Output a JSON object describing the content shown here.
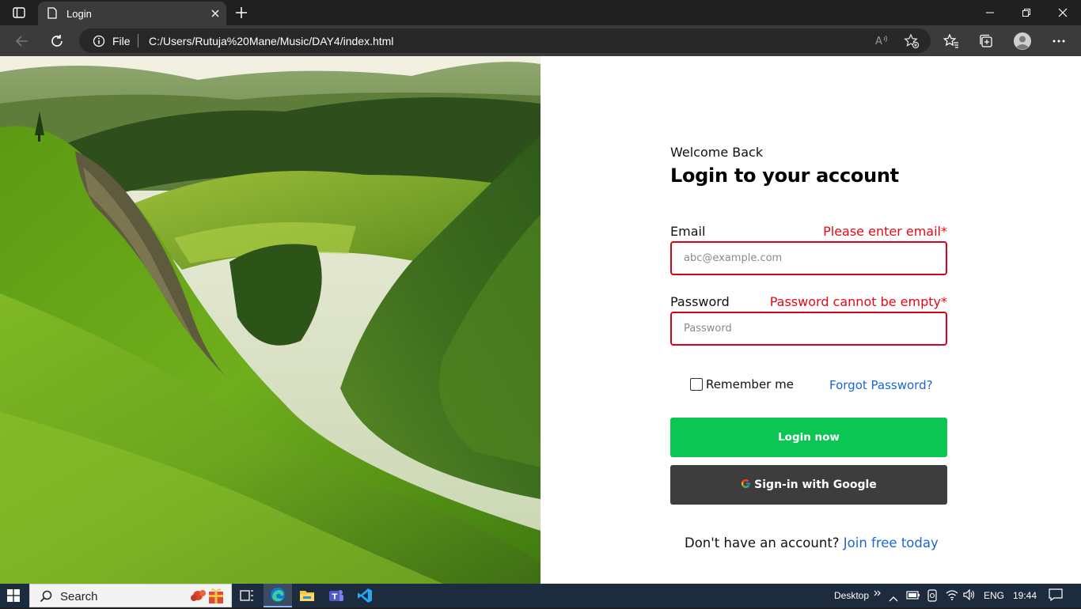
{
  "browser": {
    "tab_title": "Login",
    "url_scheme": "File",
    "url": "C:/Users/Rutuja%20Mane/Music/DAY4/index.html"
  },
  "login": {
    "welcome": "Welcome Back",
    "heading": "Login to your account",
    "email_label": "Email",
    "email_error": "Please enter email*",
    "email_placeholder": "abc@example.com",
    "password_label": "Password",
    "password_error": "Password cannot be empty*",
    "password_placeholder": "Password",
    "remember_label": "Remember me",
    "remember_checked": false,
    "forgot_label": "Forgot Password?",
    "login_button": "Login now",
    "google_button": "Sign-in with Google",
    "signup_question": "Don't have an account?",
    "signup_link": "Join free today"
  },
  "colors": {
    "error": "#e50914",
    "link": "#1a66d6",
    "login_button": "#0cc653",
    "google_button": "#3d3d3d"
  },
  "taskbar": {
    "search_label": "Search",
    "desktop_label": "Desktop",
    "language": "ENG",
    "time": "19:44"
  }
}
